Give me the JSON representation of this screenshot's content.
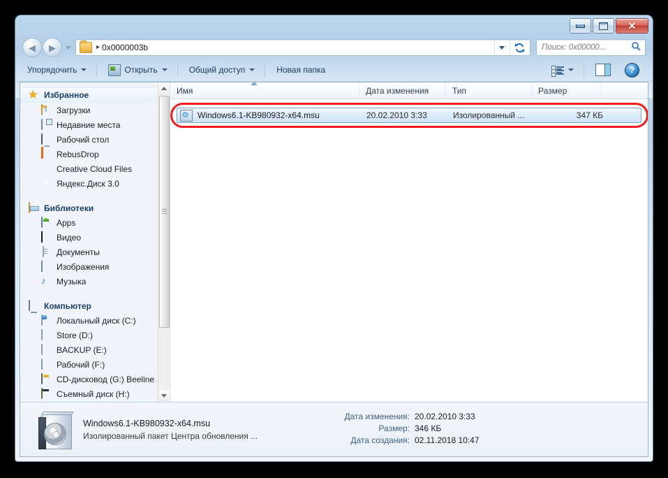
{
  "window": {
    "title": "",
    "minimize_label": "Свернуть",
    "maximize_label": "Развернуть",
    "close_label": "Закрыть"
  },
  "address_bar": {
    "back_label": "Назад",
    "forward_label": "Вперед",
    "crumb_separator": "▸",
    "path": "0x0000003b",
    "refresh_label": "Обновить"
  },
  "search": {
    "placeholder": "Поиск: 0x00000...",
    "icon": "search-icon"
  },
  "toolbar": {
    "organize": "Упорядочить",
    "open": "Открыть",
    "share": "Общий доступ",
    "new_folder": "Новая папка",
    "view_icon": "list-view-icon",
    "preview_icon": "preview-pane-icon",
    "help_icon": "help-icon",
    "help_glyph": "?"
  },
  "sidebar": {
    "groups": [
      {
        "name": "favorites",
        "header": "Избранное",
        "icon": "star-icon",
        "items": [
          {
            "label": "Загрузки",
            "icon": "downloads-folder-icon"
          },
          {
            "label": "Недавние места",
            "icon": "recent-places-icon"
          },
          {
            "label": "Рабочий стол",
            "icon": "desktop-icon"
          },
          {
            "label": "RebusDrop",
            "icon": "rebusdrop-icon"
          },
          {
            "label": "Creative Cloud Files",
            "icon": "creative-cloud-icon"
          },
          {
            "label": "Яндекс.Диск 3.0",
            "icon": "yandex-disk-icon"
          }
        ]
      },
      {
        "name": "libraries",
        "header": "Библиотеки",
        "icon": "libraries-icon",
        "items": [
          {
            "label": "Apps",
            "icon": "apps-library-icon"
          },
          {
            "label": "Видео",
            "icon": "video-library-icon"
          },
          {
            "label": "Документы",
            "icon": "documents-library-icon"
          },
          {
            "label": "Изображения",
            "icon": "pictures-library-icon"
          },
          {
            "label": "Музыка",
            "icon": "music-library-icon"
          }
        ]
      },
      {
        "name": "computer",
        "header": "Компьютер",
        "icon": "computer-icon",
        "items": [
          {
            "label": "Локальный диск (C:)",
            "icon": "system-drive-icon"
          },
          {
            "label": "Store (D:)",
            "icon": "hard-drive-icon"
          },
          {
            "label": "BACKUP (E:)",
            "icon": "hard-drive-icon"
          },
          {
            "label": "Рабочий (F:)",
            "icon": "hard-drive-icon"
          },
          {
            "label": "CD-дисковод (G:) Beeline",
            "icon": "cd-drive-icon"
          },
          {
            "label": "Съемный диск (H:)",
            "icon": "removable-drive-icon"
          }
        ]
      }
    ]
  },
  "file_list": {
    "columns": [
      {
        "key": "name",
        "label": "Имя",
        "sorted": "asc"
      },
      {
        "key": "date",
        "label": "Дата изменения"
      },
      {
        "key": "type",
        "label": "Тип"
      },
      {
        "key": "size",
        "label": "Размер"
      }
    ],
    "rows": [
      {
        "name": "Windows6.1-KB980932-x64.msu",
        "date": "20.02.2010 3:33",
        "type": "Изолированный ...",
        "size": "347 КБ",
        "icon": "msu-package-icon",
        "selected": true,
        "highlighted": true
      }
    ]
  },
  "annotation": {
    "color": "#ee1c1c",
    "shape": "rounded-rect",
    "target": "selected-file-row"
  },
  "details_pane": {
    "icon": "msu-package-large-icon",
    "title": "Windows6.1-KB980932-x64.msu",
    "subtitle": "Изолированный пакет Центра обновления ...",
    "fields": [
      {
        "label": "Дата изменения:",
        "value": "20.02.2010 3:33"
      },
      {
        "label": "Размер:",
        "value": "346 КБ"
      },
      {
        "label": "Дата создания:",
        "value": "02.11.2018 10:47"
      }
    ]
  }
}
